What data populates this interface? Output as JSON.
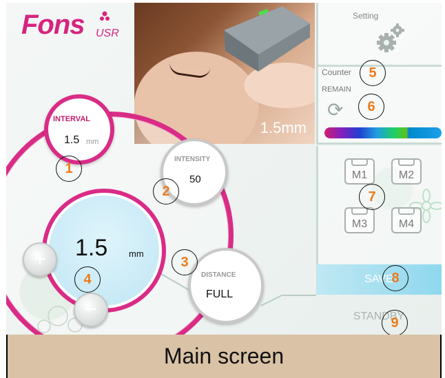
{
  "app": {
    "logo_text": "Fons",
    "logo_suffix": "USR"
  },
  "preview": {
    "depth_label": "1.5mm"
  },
  "settings": {
    "label": "Setting",
    "icon": "gear-icon"
  },
  "counter": {
    "label": "Counter",
    "remain_label": "REMAIN",
    "refresh_icon": "refresh-icon"
  },
  "memory": {
    "buttons": [
      "M1",
      "M2",
      "M3",
      "M4"
    ]
  },
  "actions": {
    "save_label": "SAVE",
    "standby_label": "STANDBY"
  },
  "interval": {
    "title": "INTERVAL",
    "value": "1.5",
    "unit": "mm"
  },
  "intensity": {
    "title": "INTENSITY",
    "value": "50"
  },
  "distance": {
    "title": "DISTANCE",
    "value": "FULL"
  },
  "depth_control": {
    "value": "1.5",
    "unit": "mm",
    "plus_label": "+",
    "minus_label": "−"
  },
  "markers": [
    "1",
    "2",
    "3",
    "4",
    "5",
    "6",
    "7",
    "8",
    "9"
  ],
  "caption": "Main screen",
  "colors": {
    "accent": "#d92c86",
    "marker": "#ef7a1a",
    "save_bg": "#8fd8ee",
    "caption_bg": "#d9c2a5"
  }
}
